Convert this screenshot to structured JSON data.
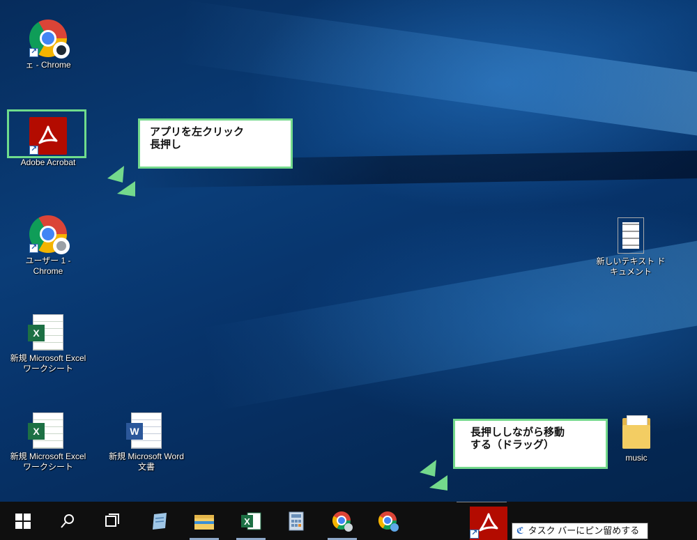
{
  "desktop_icons": [
    {
      "label": "ェ - Chrome"
    },
    {
      "label": "Adobe Acrobat"
    },
    {
      "label": "ユーザー 1 - Chrome"
    },
    {
      "label": "新規 Microsoft Excel ワークシート"
    },
    {
      "label": "新規 Microsoft Excel ワークシート"
    },
    {
      "label": "新規 Microsoft Word 文書"
    },
    {
      "label": "新しいテキスト ドキュメント"
    },
    {
      "label": "music"
    }
  ],
  "callouts": {
    "step1": "アプリを左クリック\n長押し",
    "step2": "長押ししながら移動\nする（ドラッグ）"
  },
  "taskbar": {
    "pin_tooltip": "タスク バーにピン留めする",
    "pin_tooltip_icon": "pin-icon"
  },
  "colors": {
    "highlight": "#6fdc8c",
    "acrobat_red": "#b30b00",
    "excel_green": "#1d7044",
    "word_blue": "#2b579a"
  }
}
